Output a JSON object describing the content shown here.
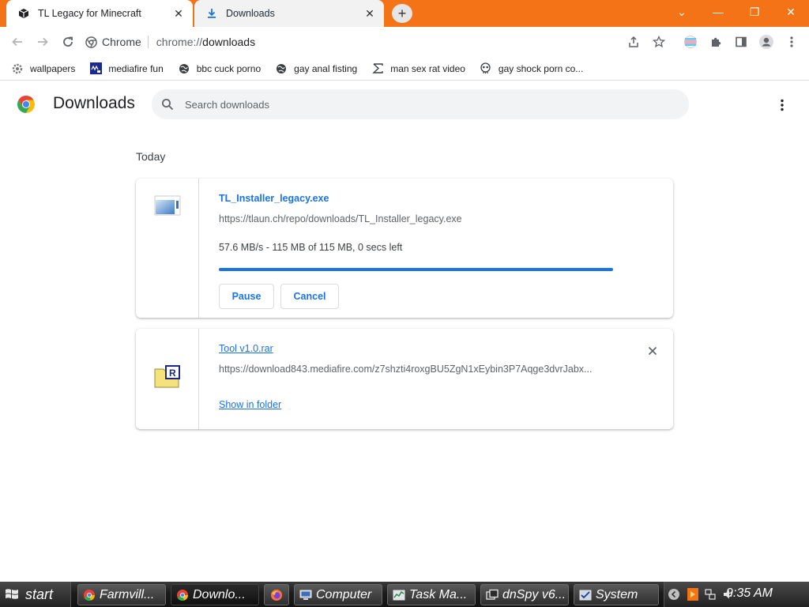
{
  "tabs": [
    {
      "title": "TL Legacy for Minecraft",
      "icon": "cube-icon",
      "active": true
    },
    {
      "title": "Downloads",
      "icon": "download-icon",
      "active": false
    }
  ],
  "toolbar": {
    "site_label": "Chrome",
    "url_scheme": "chrome://",
    "url_path": "downloads"
  },
  "bookmarks": [
    {
      "label": "wallpapers",
      "icon": "gear-icon"
    },
    {
      "label": "mediafire fun",
      "icon": "mediafire-icon"
    },
    {
      "label": "bbc cuck porno",
      "icon": "globe-icon"
    },
    {
      "label": "gay anal fisting",
      "icon": "globe-icon"
    },
    {
      "label": "man sex rat video",
      "icon": "sigma-icon"
    },
    {
      "label": "gay shock porn co...",
      "icon": "skull-icon"
    }
  ],
  "downloads_page": {
    "title": "Downloads",
    "search_placeholder": "Search downloads",
    "section": "Today",
    "items": [
      {
        "file_name": "TL_Installer_legacy.exe",
        "url": "https://tlaun.ch/repo/downloads/TL_Installer_legacy.exe",
        "status": "57.6 MB/s - 115 MB of 115 MB, 0 secs left",
        "progress_percent": 100,
        "pause_label": "Pause",
        "cancel_label": "Cancel"
      },
      {
        "file_name": "Tool v1.0.rar",
        "url": "https://download843.mediafire.com/z7shzti4roxgBU5ZgN1xEybin3P7Aqge3dvrJabx...",
        "show_in_folder_label": "Show in folder"
      }
    ]
  },
  "taskbar": {
    "start_label": "start",
    "tasks": [
      "Farmvill...",
      "Downlo...",
      "",
      "Computer",
      "Task Ma...",
      "dnSpy v6...",
      "System"
    ],
    "clock": "9:35 AM"
  },
  "colors": {
    "tab_strip": "#f47317",
    "accent": "#1a73e8"
  }
}
